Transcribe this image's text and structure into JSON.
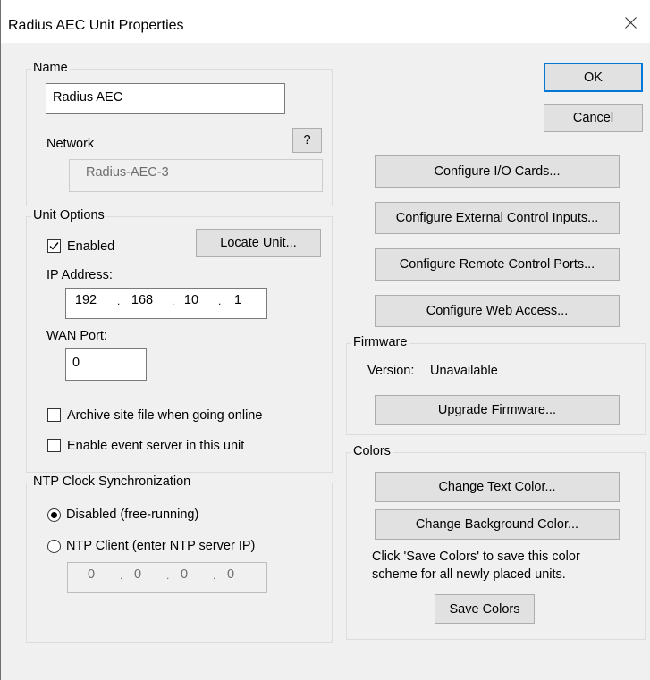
{
  "window": {
    "title": "Radius AEC Unit Properties"
  },
  "name_group": {
    "legend": "Name",
    "name_value": "Radius AEC",
    "network_label": "Network",
    "help_label": "?",
    "network_value": "Radius-AEC-3"
  },
  "unit_options": {
    "legend": "Unit Options",
    "enabled_label": "Enabled",
    "enabled_checked": true,
    "locate_label": "Locate Unit...",
    "ip_label": "IP Address:",
    "ip": [
      "192",
      "168",
      "10",
      "1"
    ],
    "wan_label": "WAN Port:",
    "wan_value": "0",
    "archive_label": "Archive site file when going online",
    "archive_checked": false,
    "event_server_label": "Enable event server in this unit",
    "event_server_checked": false
  },
  "ntp": {
    "legend": "NTP Clock Synchronization",
    "disabled_label": "Disabled (free-running)",
    "client_label": "NTP Client (enter NTP server IP)",
    "selected": "disabled",
    "ip": [
      "0",
      "0",
      "0",
      "0"
    ]
  },
  "buttons": {
    "ok": "OK",
    "cancel": "Cancel",
    "configure_io": "Configure I/O Cards...",
    "configure_external": "Configure External Control Inputs...",
    "configure_remote": "Configure Remote Control Ports...",
    "configure_web": "Configure Web Access..."
  },
  "firmware": {
    "legend": "Firmware",
    "version_label": "Version:",
    "version_value": "Unavailable",
    "upgrade_label": "Upgrade Firmware..."
  },
  "colors": {
    "legend": "Colors",
    "change_text": "Change Text Color...",
    "change_background": "Change Background Color...",
    "note_line1": "Click 'Save Colors' to save this color",
    "note_line2": "scheme for all newly placed units.",
    "save_label": "Save Colors"
  },
  "icons": {
    "close": "close-icon",
    "check": "checkmark-icon"
  },
  "theme": {
    "dialog_bg": "#f0f0f0",
    "titlebar_bg": "#ffffff",
    "default_button_border": "#0078d7"
  }
}
